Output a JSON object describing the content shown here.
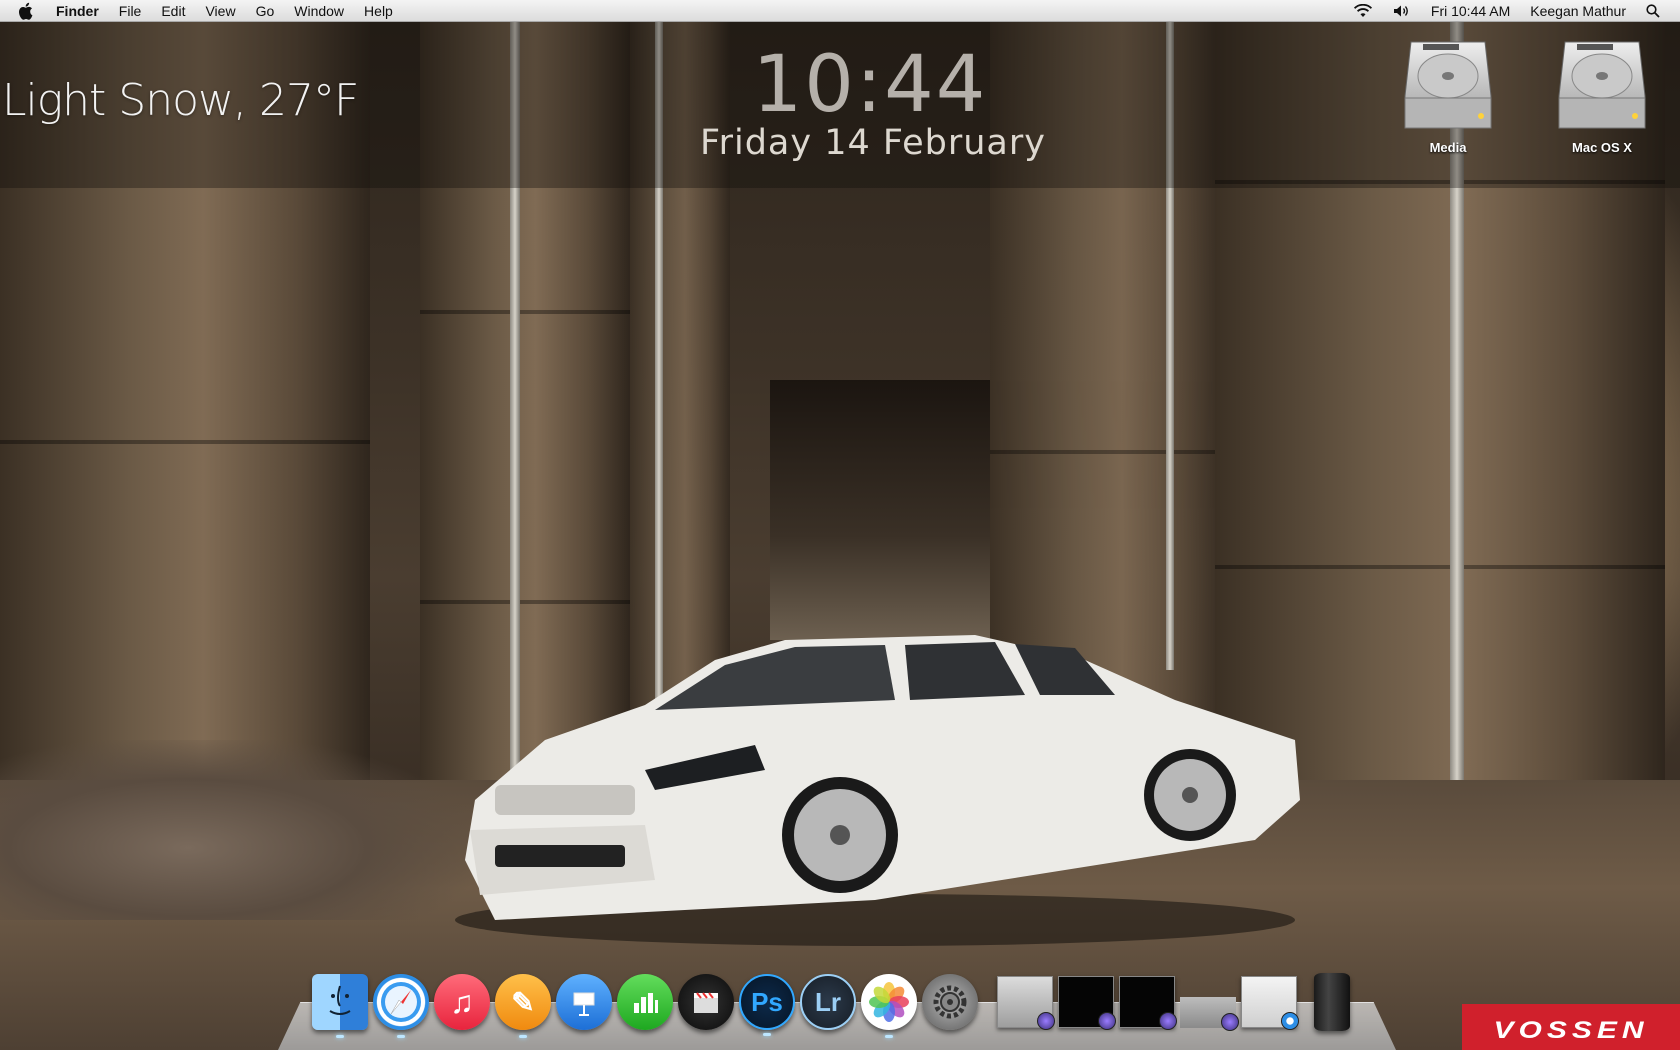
{
  "menubar": {
    "app_name": "Finder",
    "menus": [
      "File",
      "Edit",
      "View",
      "Go",
      "Window",
      "Help"
    ],
    "clock": "Fri 10:44 AM",
    "user": "Keegan Mathur"
  },
  "widgets": {
    "weather": "Light Snow, 27°F",
    "time": "10:44",
    "date": "Friday 14 February"
  },
  "desktop_icons": [
    {
      "label": "Media",
      "icon": "hard-drive-icon"
    },
    {
      "label": "Mac OS X",
      "icon": "hard-drive-icon"
    }
  ],
  "dock": {
    "apps": [
      {
        "name": "Finder",
        "icon": "finder-icon",
        "color": "#4a9ee6",
        "glyph": ""
      },
      {
        "name": "Safari",
        "icon": "safari-icon",
        "color": "#2f8fe0",
        "glyph": ""
      },
      {
        "name": "iTunes",
        "icon": "music-note-icon",
        "color": "#f04a5c",
        "glyph": "♫"
      },
      {
        "name": "Pages",
        "icon": "pages-icon",
        "color": "#f59a1f",
        "glyph": "✎"
      },
      {
        "name": "Keynote",
        "icon": "keynote-icon",
        "color": "#2d8df0",
        "glyph": ""
      },
      {
        "name": "Numbers",
        "icon": "numbers-icon",
        "color": "#3ac43d",
        "glyph": ""
      },
      {
        "name": "Final Cut Pro",
        "icon": "clapper-icon",
        "color": "#1b1b1b",
        "glyph": ""
      },
      {
        "name": "Photoshop",
        "icon": "photoshop-icon",
        "color": "#0c2340",
        "glyph": "Ps"
      },
      {
        "name": "Lightroom",
        "icon": "lightroom-icon",
        "color": "#2c3540",
        "glyph": "Lr"
      },
      {
        "name": "Photos",
        "icon": "photos-icon",
        "color": "#ffffff",
        "glyph": ""
      },
      {
        "name": "System Preferences",
        "icon": "gear-icon",
        "color": "#8a8a8a",
        "glyph": ""
      }
    ],
    "vossen_logo": "VOSSEN"
  }
}
